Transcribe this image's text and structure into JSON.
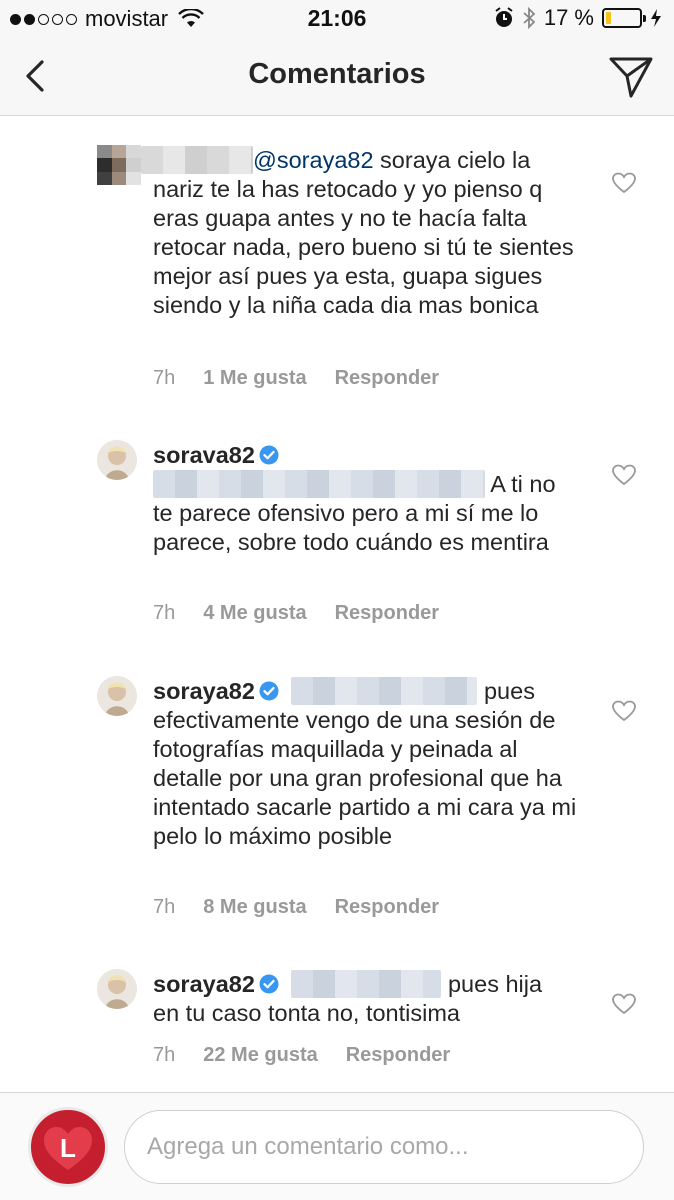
{
  "status_bar": {
    "carrier": "movistar",
    "time": "21:06",
    "battery_percent": "17 %",
    "battery_level": 0.17
  },
  "nav": {
    "title": "Comentarios"
  },
  "comments": [
    {
      "mention": "@soraya82",
      "text_line1": " soraya cielo la",
      "text_rest": "nariz te la has retocado y yo pienso q eras guapa antes y no te hacía falta retocar nada, pero bueno si tú te sientes mejor así pues ya esta, guapa sigues siendo y la niña cada dia mas bonica",
      "time": "7h",
      "likes": "1 Me gusta",
      "reply": "Responder"
    },
    {
      "username": "sorava82",
      "text_line2": "A ti no",
      "text_rest": "te parece ofensivo pero a mi sí me lo parece, sobre todo cuándo es mentira",
      "time": "7h",
      "likes": "4 Me gusta",
      "reply": "Responder"
    },
    {
      "username": "soraya82",
      "text_line1": "pues",
      "text_rest": "efectivamente vengo de una sesión de fotografías maquillada y peinada al detalle por una gran profesional que ha intentado sacarle partido a mi cara ya mi pelo lo máximo posible",
      "time": "7h",
      "likes": "8 Me gusta",
      "reply": "Responder"
    },
    {
      "username": "soraya82",
      "text_line1": "pues hija",
      "text_rest": "en tu caso tonta no, tontisima",
      "time": "7h",
      "likes": "22 Me gusta",
      "reply": "Responder"
    }
  ],
  "composer": {
    "placeholder": "Agrega un comentario como...",
    "avatar_letter": "L"
  },
  "colors": {
    "text": "#262626",
    "meta": "#999999",
    "mention": "#003569",
    "verified": "#3897f0",
    "brand_badge": "#c51e2f"
  }
}
